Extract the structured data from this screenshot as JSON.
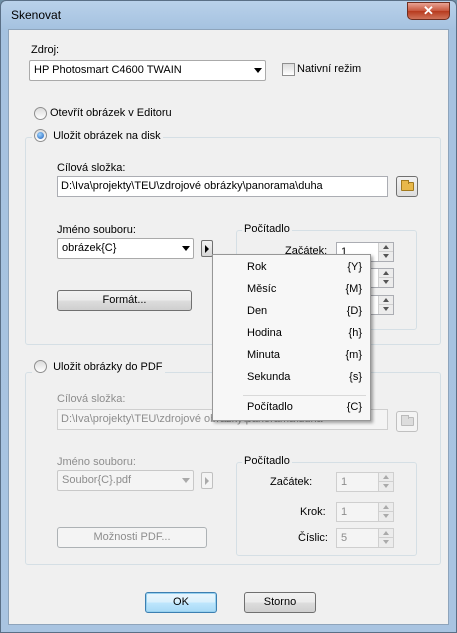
{
  "window": {
    "title": "Skenovat",
    "close_glyph": "✕"
  },
  "source": {
    "label": "Zdroj:",
    "selected": "HP Photosmart C4600 TWAIN",
    "native_mode_label": "Nativní režim",
    "native_mode_checked": false
  },
  "open_in_editor": {
    "label": "Otevřít obrázek v Editoru",
    "selected": false
  },
  "save_to_disk": {
    "label": "Uložit obrázek na disk",
    "selected": true,
    "folder_label": "Cílová složka:",
    "folder_value": "D:\\Iva\\projekty\\TEU\\zdrojové obrázky\\panorama\\duha",
    "filename_label": "Jméno souboru:",
    "filename_value": "obrázek{C}",
    "format_button": "Formát...",
    "counter": {
      "title": "Počítadlo",
      "start_label": "Začátek:",
      "start_value": "1"
    }
  },
  "popup_menu": {
    "items": [
      {
        "label": "Rok",
        "token": "{Y}"
      },
      {
        "label": "Měsíc",
        "token": "{M}"
      },
      {
        "label": "Den",
        "token": "{D}"
      },
      {
        "label": "Hodina",
        "token": "{h}"
      },
      {
        "label": "Minuta",
        "token": "{m}"
      },
      {
        "label": "Sekunda",
        "token": "{s}"
      },
      {
        "label": "Počítadlo",
        "token": "{C}"
      }
    ]
  },
  "save_to_pdf": {
    "label": "Uložit obrázky do PDF",
    "selected": false,
    "folder_label": "Cílová složka:",
    "folder_value": "D:\\Iva\\projekty\\TEU\\zdrojové obrázky\\panorama\\duha",
    "filename_label": "Jméno souboru:",
    "filename_value": "Soubor{C}.pdf",
    "options_button": "Možnosti PDF...",
    "counter": {
      "title": "Počítadlo",
      "start_label": "Začátek:",
      "start_value": "1",
      "step_label": "Krok:",
      "step_value": "1",
      "digits_label": "Číslic:",
      "digits_value": "5"
    }
  },
  "buttons": {
    "ok": "OK",
    "cancel": "Storno"
  },
  "colors": {
    "accent_blue": "#3c7fb1",
    "disabled_text": "#8d8d8d",
    "title_bar": "#b9d1ea"
  }
}
